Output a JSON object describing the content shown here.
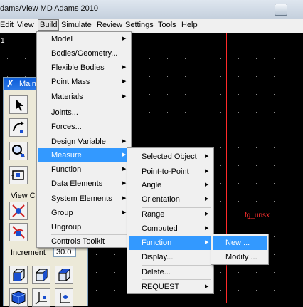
{
  "window": {
    "title": "dams/View MD Adams 2010"
  },
  "menubar": {
    "items": [
      "Edit",
      "View",
      "Build",
      "Simulate",
      "Review",
      "Settings",
      "Tools",
      "Help"
    ],
    "active": "Build"
  },
  "viewport": {
    "corner_label": "1",
    "overlay_label": "fg_unsx"
  },
  "toolbox": {
    "title": "Main",
    "view_label": "View Co",
    "increment_label": "Increment",
    "increment_value": "30.0"
  },
  "build_menu": {
    "items": [
      {
        "label": "Model",
        "submenu": true
      },
      {
        "label": "Bodies/Geometry...",
        "submenu": false
      },
      {
        "label": "Flexible Bodies",
        "submenu": true
      },
      {
        "label": "Point Mass",
        "submenu": true
      },
      {
        "label": "Materials",
        "submenu": true
      },
      {
        "label": "Joints...",
        "submenu": false
      },
      {
        "label": "Forces...",
        "submenu": false
      },
      {
        "label": "Design Variable",
        "submenu": true
      },
      {
        "label": "Measure",
        "submenu": true,
        "highlighted": true
      },
      {
        "label": "Function",
        "submenu": true
      },
      {
        "label": "Data Elements",
        "submenu": true
      },
      {
        "label": "System Elements",
        "submenu": true
      },
      {
        "label": "Group",
        "submenu": true
      },
      {
        "label": "Ungroup",
        "submenu": false
      },
      {
        "label": "Controls Toolkit",
        "submenu": false
      }
    ]
  },
  "measure_menu": {
    "items": [
      {
        "label": "Selected Object",
        "submenu": true
      },
      {
        "label": "Point-to-Point",
        "submenu": true
      },
      {
        "label": "Angle",
        "submenu": true
      },
      {
        "label": "Orientation",
        "submenu": true
      },
      {
        "label": "Range",
        "submenu": true
      },
      {
        "label": "Computed",
        "submenu": true
      },
      {
        "label": "Function",
        "submenu": true,
        "highlighted": true
      },
      {
        "label": "Display...",
        "submenu": false
      },
      {
        "label": "Delete...",
        "submenu": false
      },
      {
        "label": "REQUEST",
        "submenu": true
      }
    ]
  },
  "function_menu": {
    "items": [
      {
        "label": "New ...",
        "highlighted": true
      },
      {
        "label": "Modify ..."
      }
    ]
  },
  "colors": {
    "highlight": "#3399ff",
    "viewport_background": "#000000",
    "axis_line": "#ff2a2a",
    "toolbox_title": "#0a5bd8"
  }
}
